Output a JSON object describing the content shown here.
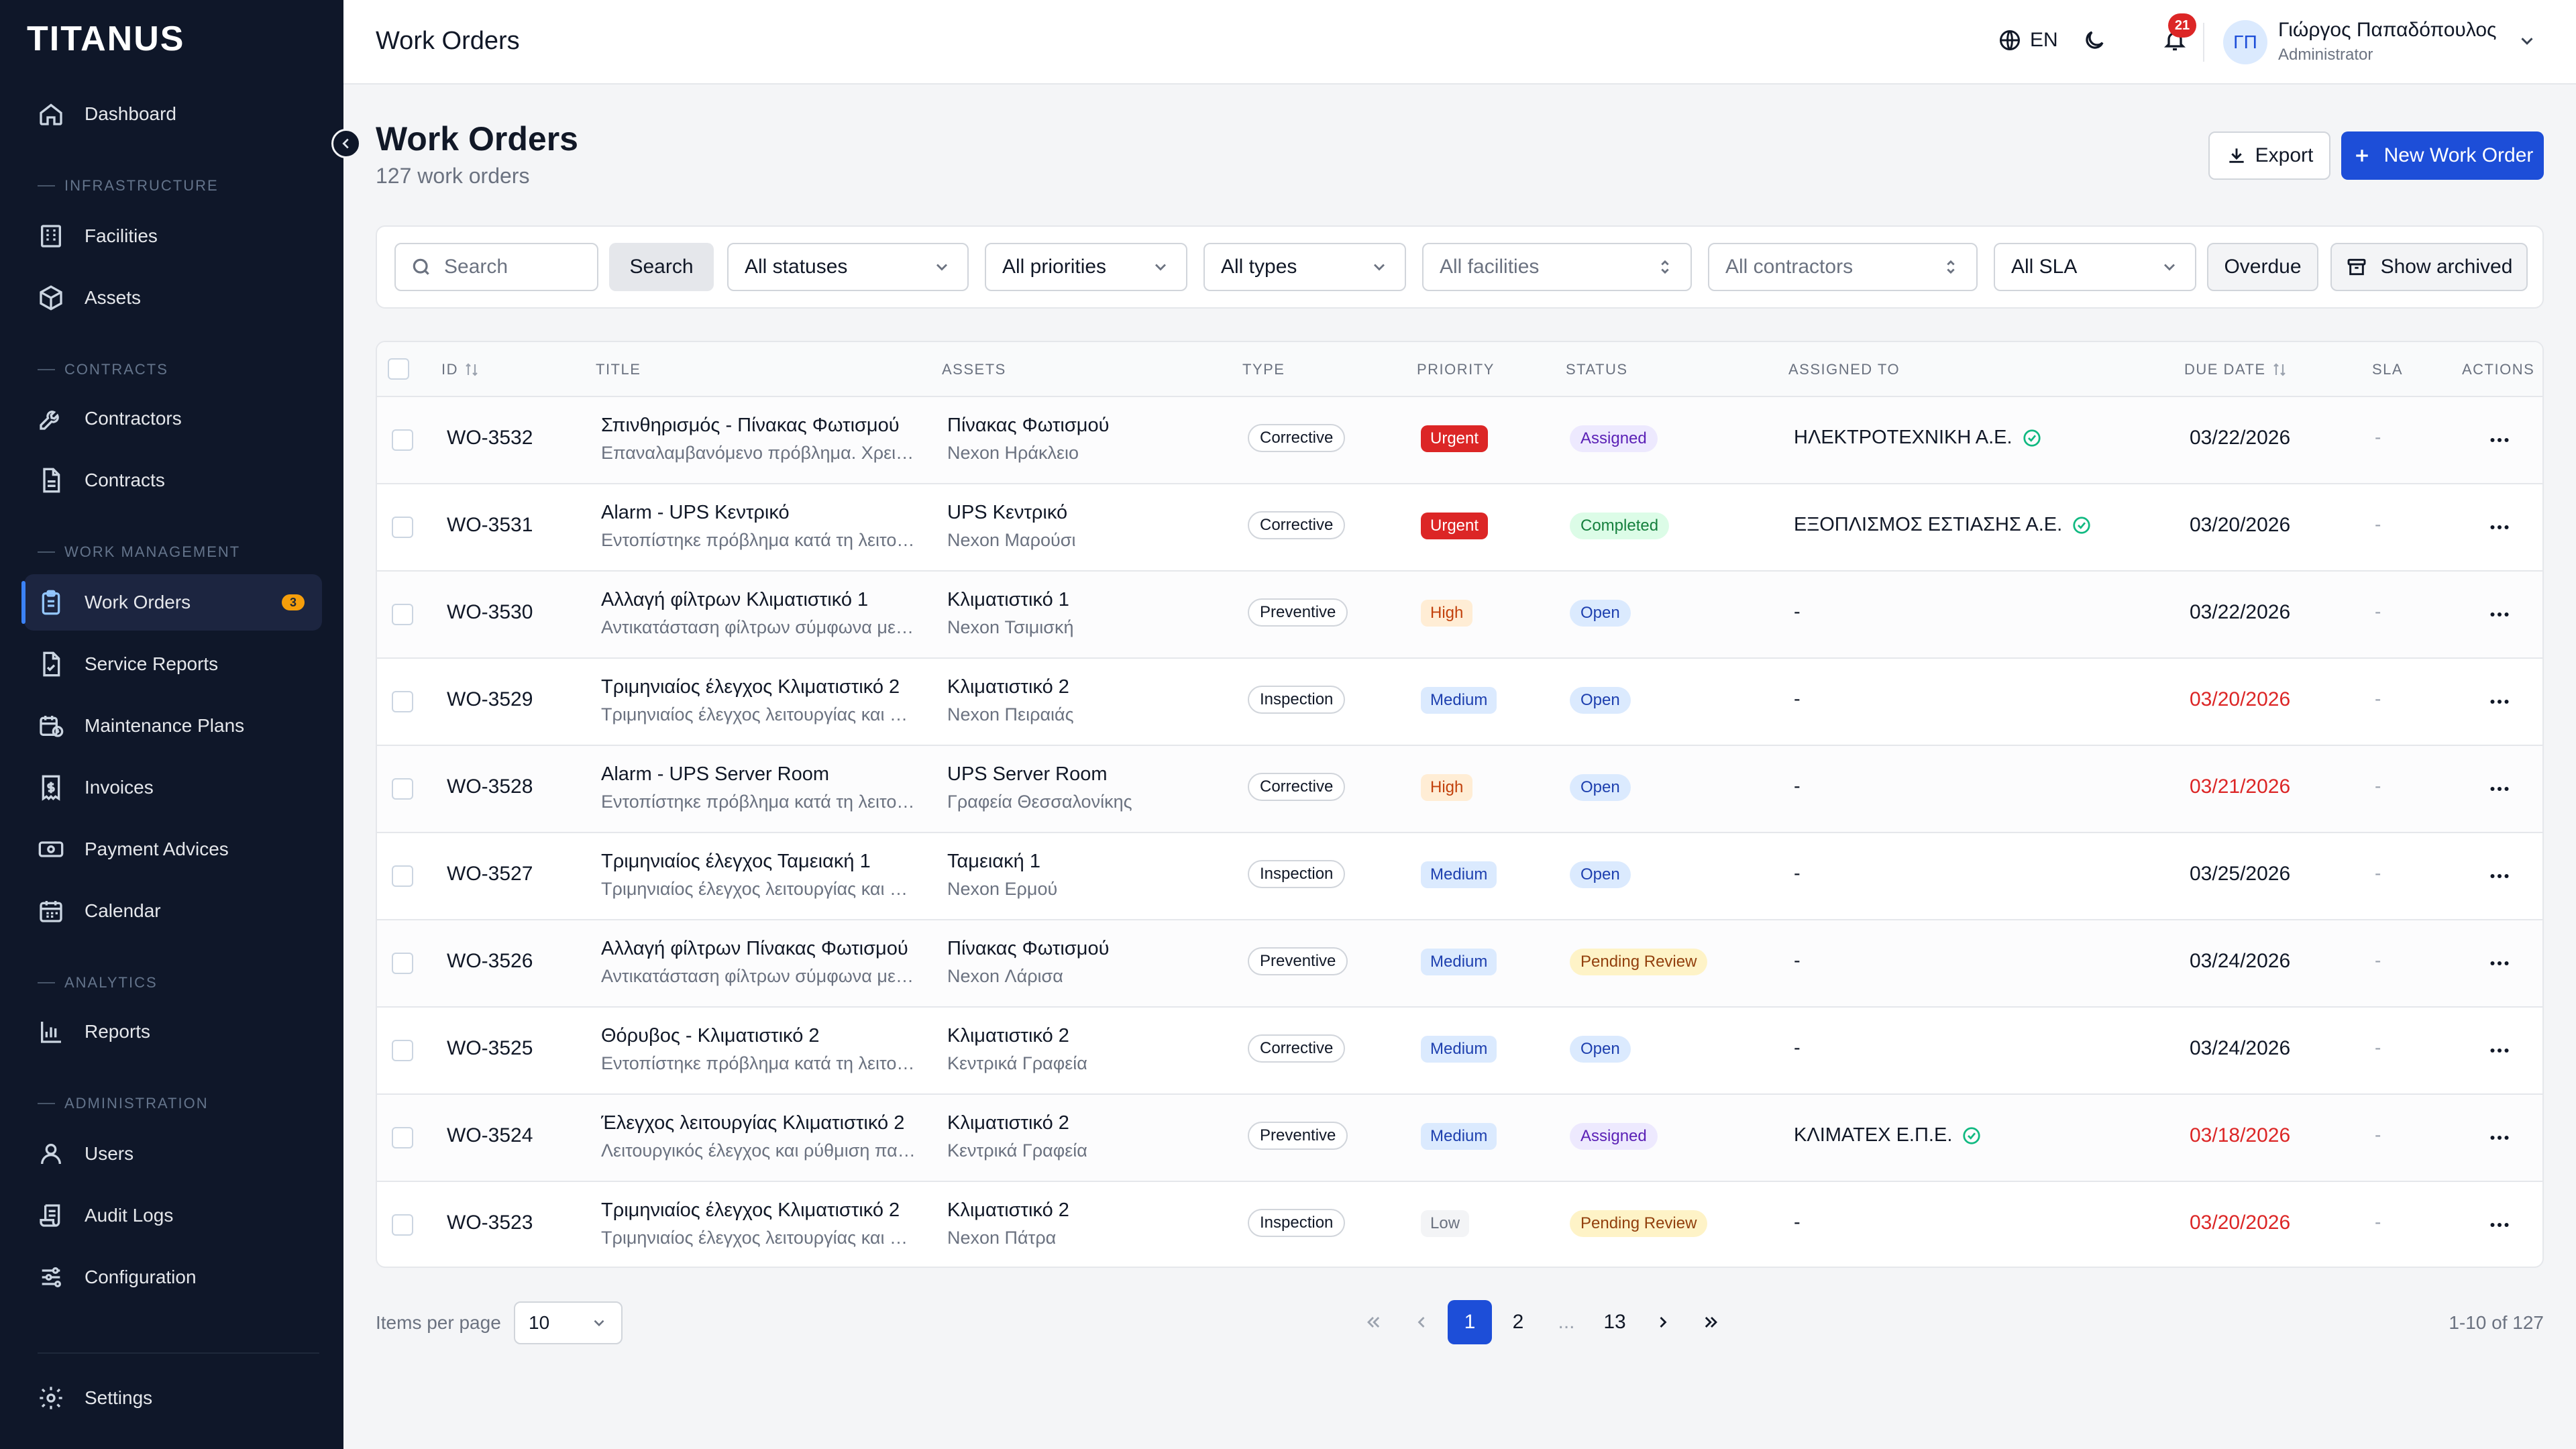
{
  "app": {
    "logo": "TITANUS"
  },
  "sidebar": {
    "items": [
      {
        "label": "Dashboard",
        "icon": "home-icon"
      },
      {
        "label": "Facilities",
        "icon": "building-icon"
      },
      {
        "label": "Assets",
        "icon": "box-icon"
      },
      {
        "label": "Contractors",
        "icon": "wrench-icon"
      },
      {
        "label": "Contracts",
        "icon": "document-icon"
      },
      {
        "label": "Work Orders",
        "icon": "clipboard-icon",
        "badge": "3",
        "active": true
      },
      {
        "label": "Service Reports",
        "icon": "file-check-icon"
      },
      {
        "label": "Maintenance Plans",
        "icon": "calendar-clock-icon"
      },
      {
        "label": "Invoices",
        "icon": "receipt-icon"
      },
      {
        "label": "Payment Advices",
        "icon": "banknote-icon"
      },
      {
        "label": "Calendar",
        "icon": "calendar-icon"
      },
      {
        "label": "Reports",
        "icon": "bar-chart-icon"
      },
      {
        "label": "Users",
        "icon": "user-icon"
      },
      {
        "label": "Audit Logs",
        "icon": "scroll-icon"
      },
      {
        "label": "Configuration",
        "icon": "sliders-icon"
      },
      {
        "label": "Settings",
        "icon": "gear-icon"
      }
    ],
    "sections": {
      "infrastructure": "INFRASTRUCTURE",
      "contracts": "CONTRACTS",
      "work_management": "WORK MANAGEMENT",
      "analytics": "ANALYTICS",
      "administration": "ADMINISTRATION"
    }
  },
  "header": {
    "title": "Work Orders",
    "language": "EN",
    "notifications": "21",
    "user": {
      "initials": "ΓΠ",
      "name": "Γιώργος Παπαδόπουλος",
      "role": "Administrator"
    }
  },
  "page": {
    "title": "Work Orders",
    "subtitle": "127 work orders",
    "export_label": "Export",
    "new_label": "New Work Order"
  },
  "filters": {
    "search_placeholder": "Search",
    "search_button": "Search",
    "status": "All statuses",
    "priority": "All priorities",
    "type": "All types",
    "facility": "All facilities",
    "contractor": "All contractors",
    "sla": "All SLA",
    "overdue": "Overdue",
    "archived": "Show archived"
  },
  "table": {
    "columns": {
      "id": "ID",
      "title": "TITLE",
      "assets": "ASSETS",
      "type": "TYPE",
      "priority": "PRIORITY",
      "status": "STATUS",
      "assigned": "ASSIGNED TO",
      "due": "DUE DATE",
      "sla": "SLA",
      "actions": "ACTIONS"
    },
    "rows": [
      {
        "id": "WO-3532",
        "title": "Σπινθηρισμός - Πίνακας Φωτισμού",
        "desc": "Επαναλαμβανόμενο πρόβλημα. Χρειάζεται έλεγχος",
        "asset": "Πίνακας Φωτισμού",
        "site": "Nexon Ηράκλειο",
        "type": "Corrective",
        "priority": "Urgent",
        "status": "Assigned",
        "assigned": "ΗΛΕΚΤΡΟΤΕΧΝΙΚΗ Α.Ε.",
        "verified": true,
        "due": "03/22/2026",
        "overdue": false,
        "sla": "-"
      },
      {
        "id": "WO-3531",
        "title": "Alarm - UPS Κεντρικό",
        "desc": "Εντοπίστηκε πρόβλημα κατά τη λειτουργία",
        "asset": "UPS Κεντρικό",
        "site": "Nexon Μαρούσι",
        "type": "Corrective",
        "priority": "Urgent",
        "status": "Completed",
        "assigned": "ΕΞΟΠΛΙΣΜΟΣ ΕΣΤΙΑΣΗΣ Α.Ε.",
        "verified": true,
        "due": "03/20/2026",
        "overdue": false,
        "sla": "-"
      },
      {
        "id": "WO-3530",
        "title": "Αλλαγή φίλτρων Κλιματιστικό 1",
        "desc": "Αντικατάσταση φίλτρων σύμφωνα με πρόγραμμα",
        "asset": "Κλιματιστικό 1",
        "site": "Nexon Τσιμισκή",
        "type": "Preventive",
        "priority": "High",
        "status": "Open",
        "assigned": "-",
        "verified": false,
        "due": "03/22/2026",
        "overdue": false,
        "sla": "-"
      },
      {
        "id": "WO-3529",
        "title": "Τριμηνιαίος έλεγχος Κλιματιστικό 2",
        "desc": "Τριμηνιαίος έλεγχος λειτουργίας και καθαρισμός",
        "asset": "Κλιματιστικό 2",
        "site": "Nexon Πειραιάς",
        "type": "Inspection",
        "priority": "Medium",
        "status": "Open",
        "assigned": "-",
        "verified": false,
        "due": "03/20/2026",
        "overdue": true,
        "sla": "-"
      },
      {
        "id": "WO-3528",
        "title": "Alarm - UPS Server Room",
        "desc": "Εντοπίστηκε πρόβλημα κατά τη λειτουργία",
        "asset": "UPS Server Room",
        "site": "Γραφεία Θεσσαλονίκης",
        "type": "Corrective",
        "priority": "High",
        "status": "Open",
        "assigned": "-",
        "verified": false,
        "due": "03/21/2026",
        "overdue": true,
        "sla": "-"
      },
      {
        "id": "WO-3527",
        "title": "Τριμηνιαίος έλεγχος Ταμειακή 1",
        "desc": "Τριμηνιαίος έλεγχος λειτουργίας και καθαρισμός",
        "asset": "Ταμειακή 1",
        "site": "Nexon Ερμού",
        "type": "Inspection",
        "priority": "Medium",
        "status": "Open",
        "assigned": "-",
        "verified": false,
        "due": "03/25/2026",
        "overdue": false,
        "sla": "-"
      },
      {
        "id": "WO-3526",
        "title": "Αλλαγή φίλτρων Πίνακας Φωτισμού",
        "desc": "Αντικατάσταση φίλτρων σύμφωνα με πρόγραμμα",
        "asset": "Πίνακας Φωτισμού",
        "site": "Nexon Λάρισα",
        "type": "Preventive",
        "priority": "Medium",
        "status": "Pending Review",
        "assigned": "-",
        "verified": false,
        "due": "03/24/2026",
        "overdue": false,
        "sla": "-"
      },
      {
        "id": "WO-3525",
        "title": "Θόρυβος - Κλιματιστικό 2",
        "desc": "Εντοπίστηκε πρόβλημα κατά τη λειτουργία",
        "asset": "Κλιματιστικό 2",
        "site": "Κεντρικά Γραφεία",
        "type": "Corrective",
        "priority": "Medium",
        "status": "Open",
        "assigned": "-",
        "verified": false,
        "due": "03/24/2026",
        "overdue": false,
        "sla": "-"
      },
      {
        "id": "WO-3524",
        "title": "Έλεγχος λειτουργίας Κλιματιστικό 2",
        "desc": "Λειτουργικός έλεγχος και ρύθμιση παραμέτρων",
        "asset": "Κλιματιστικό 2",
        "site": "Κεντρικά Γραφεία",
        "type": "Preventive",
        "priority": "Medium",
        "status": "Assigned",
        "assigned": "ΚΛΙΜΑΤΕΧ Ε.Π.Ε.",
        "verified": true,
        "due": "03/18/2026",
        "overdue": true,
        "sla": "-"
      },
      {
        "id": "WO-3523",
        "title": "Τριμηνιαίος έλεγχος Κλιματιστικό 2",
        "desc": "Τριμηνιαίος έλεγχος λειτουργίας και καθαρισμός",
        "asset": "Κλιματιστικό 2",
        "site": "Nexon Πάτρα",
        "type": "Inspection",
        "priority": "Low",
        "status": "Pending Review",
        "assigned": "-",
        "verified": false,
        "due": "03/20/2026",
        "overdue": true,
        "sla": "-"
      }
    ]
  },
  "pagination": {
    "items_per_page_label": "Items per page",
    "items_per_page": "10",
    "pages": [
      "1",
      "2",
      "...",
      "13"
    ],
    "current": "1",
    "range": "1-10 of 127"
  },
  "colors": {
    "sidebar_bg": "#0f1729",
    "accent": "#1d4ed8",
    "overdue": "#dc2626",
    "priority": {
      "Urgent": {
        "bg": "#dc2626",
        "fg": "#ffffff"
      },
      "High": {
        "bg": "#ffedd5",
        "fg": "#c2410c"
      },
      "Medium": {
        "bg": "#dbeafe",
        "fg": "#1e40af"
      },
      "Low": {
        "bg": "#f3f4f6",
        "fg": "#6b7280"
      }
    },
    "status": {
      "Assigned": {
        "bg": "#ede9fe",
        "fg": "#5b21b6"
      },
      "Completed": {
        "bg": "#dcfce7",
        "fg": "#15803d"
      },
      "Open": {
        "bg": "#dbeafe",
        "fg": "#1e40af"
      },
      "Pending Review": {
        "bg": "#fef3c7",
        "fg": "#92400e"
      }
    }
  }
}
